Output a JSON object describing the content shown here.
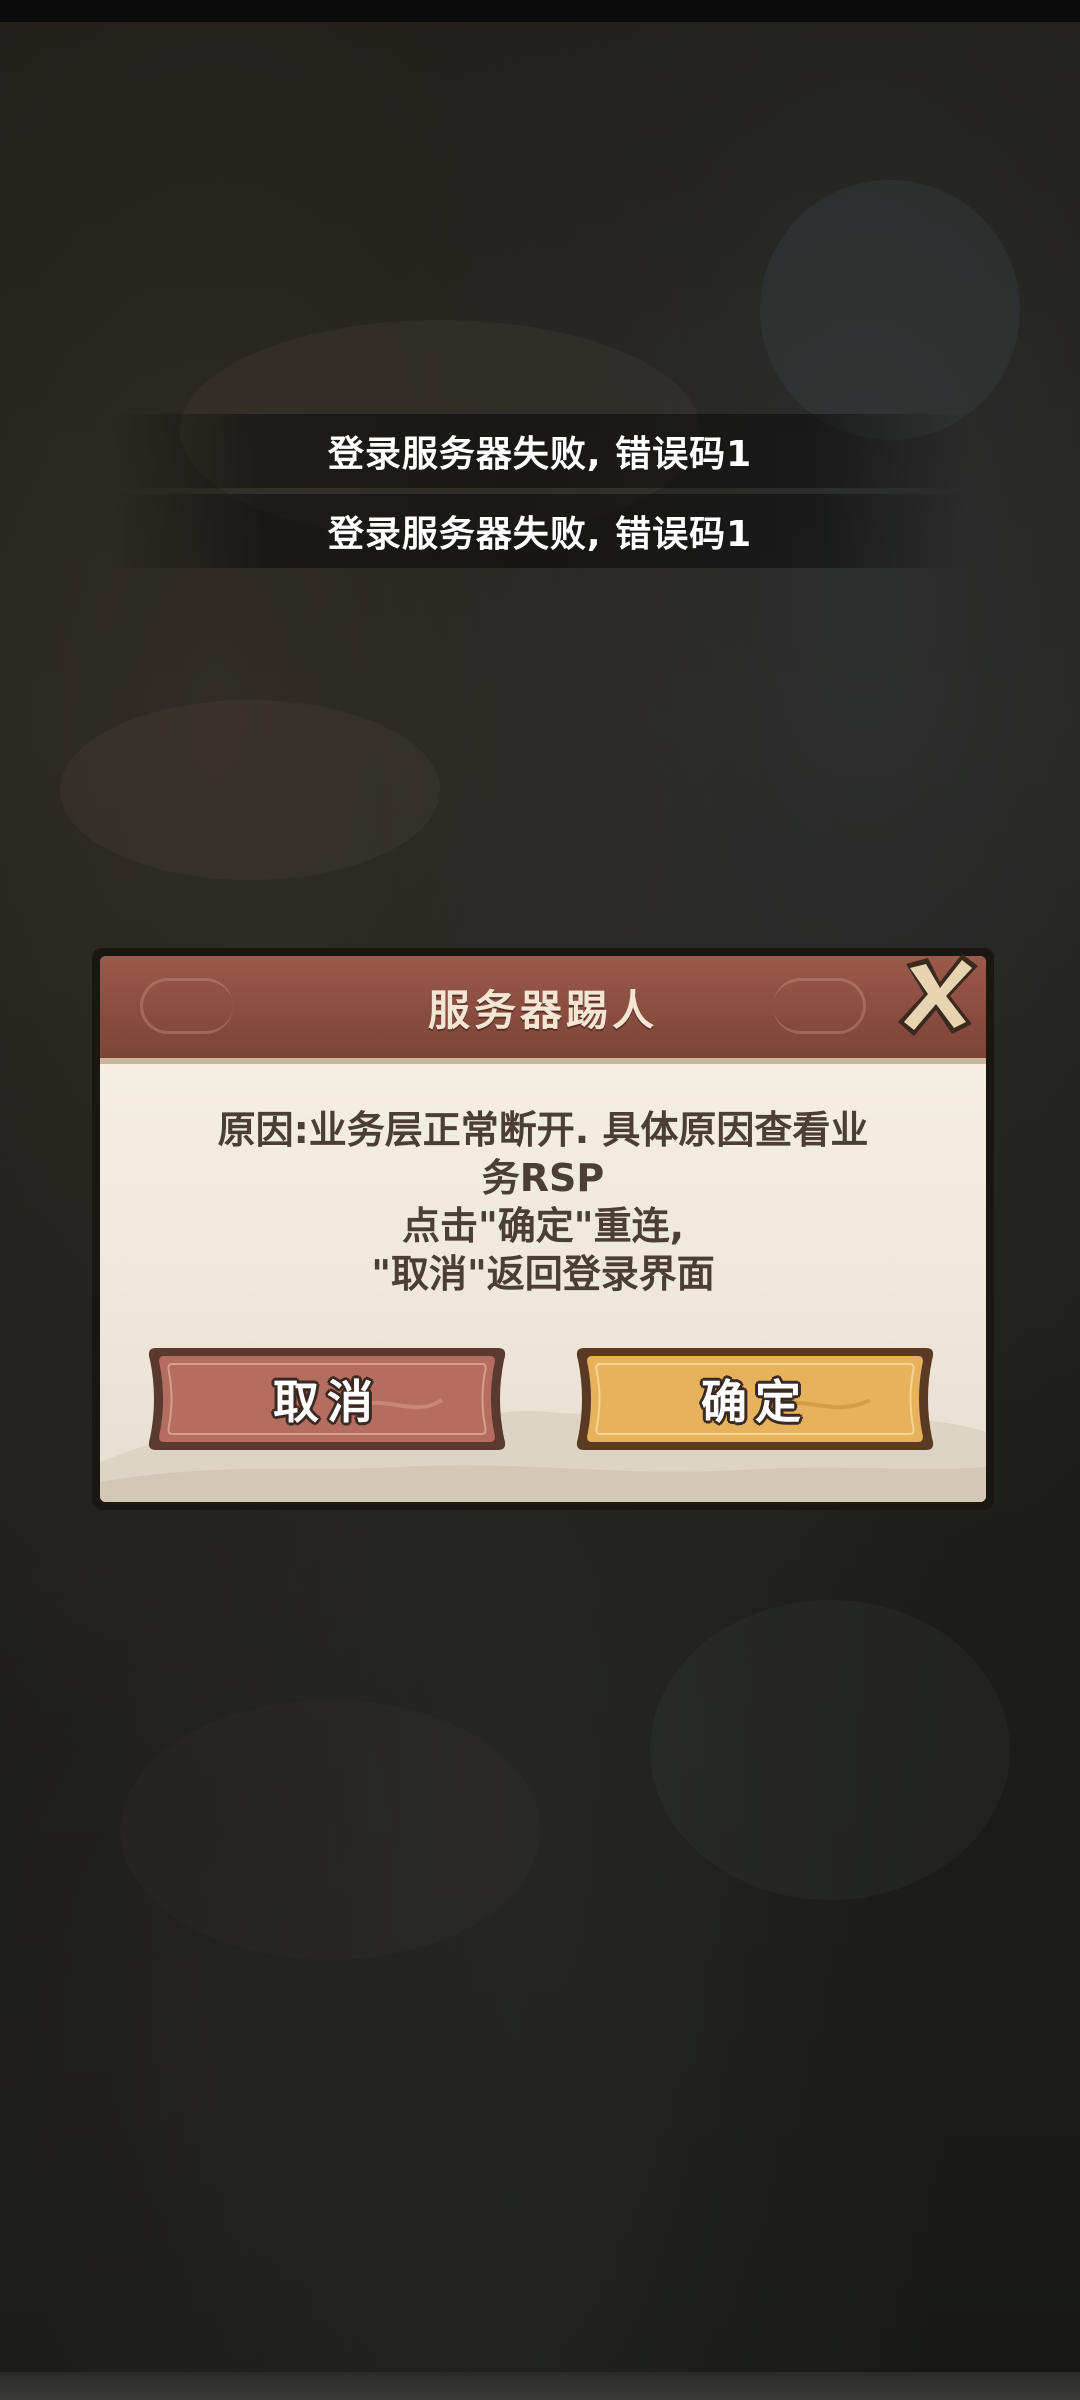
{
  "toasts": [
    {
      "text": "登录服务器失败, 错误码1"
    },
    {
      "text": "登录服务器失败, 错误码1"
    }
  ],
  "dialog": {
    "title": "服务器踢人",
    "close_icon": "close-x-icon",
    "message_lines": [
      "原因:业务层正常断开. 具体原因查看业",
      "务RSP",
      "点击\"确定\"重连,",
      "\"取消\"返回登录界面"
    ],
    "cancel_label": "取消",
    "confirm_label": "确定"
  },
  "colors": {
    "header": "#8a4d40",
    "cancel_button": "#b56e62",
    "confirm_button": "#e8b661",
    "panel": "#f3ede2"
  }
}
